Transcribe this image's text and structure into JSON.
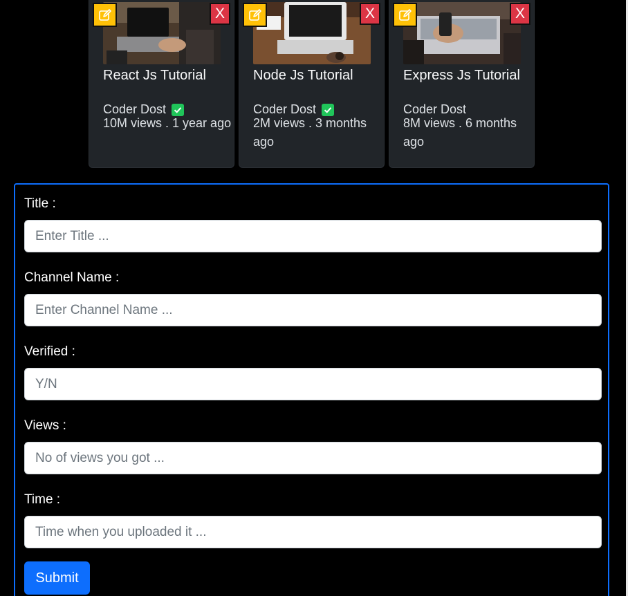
{
  "videos": [
    {
      "title": "React Js Tutorial",
      "channel": "Coder Dost",
      "verified": true,
      "meta": "10M views . 1 year ago",
      "edit_icon": "pencil-square-icon",
      "delete_label": "X",
      "thumbnail": "laptop-typing-photo"
    },
    {
      "title": "Node Js Tutorial",
      "channel": "Coder Dost",
      "verified": true,
      "meta": "2M views . 3 months ago",
      "edit_icon": "pencil-square-icon",
      "delete_label": "X",
      "thumbnail": "laptop-desk-photo"
    },
    {
      "title": "Express Js Tutorial",
      "channel": "Coder Dost",
      "verified": false,
      "meta": "8M views . 6 months ago",
      "edit_icon": "pencil-square-icon",
      "delete_label": "X",
      "thumbnail": "phone-laptop-photo"
    }
  ],
  "form": {
    "fields": [
      {
        "label": "Title :",
        "placeholder": "Enter Title ...",
        "value": ""
      },
      {
        "label": "Channel Name :",
        "placeholder": "Enter Channel Name ...",
        "value": ""
      },
      {
        "label": "Verified :",
        "placeholder": "Y/N",
        "value": ""
      },
      {
        "label": "Views :",
        "placeholder": "No of views you got ...",
        "value": ""
      },
      {
        "label": "Time :",
        "placeholder": "Time when you uploaded it ...",
        "value": ""
      }
    ],
    "submit_label": "Submit"
  },
  "colors": {
    "background": "#000000",
    "card": "#212529",
    "edit": "#ffc107",
    "delete": "#dc3545",
    "verified": "#20c55a",
    "primary": "#0d6efd"
  }
}
